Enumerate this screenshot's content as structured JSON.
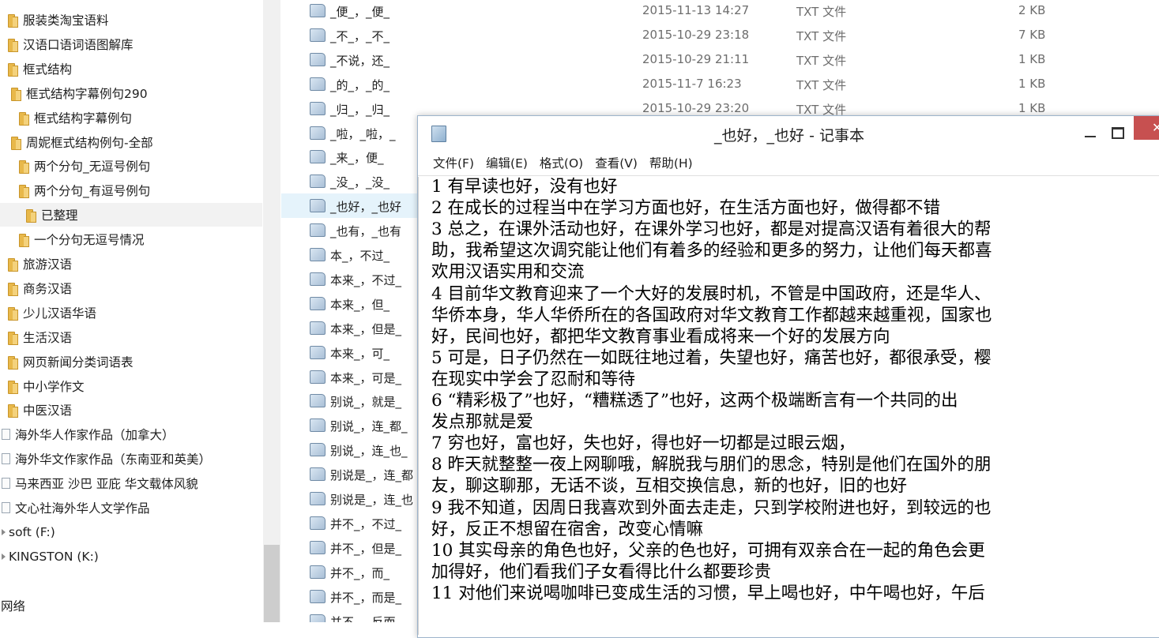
{
  "nav": {
    "items": [
      {
        "label": "服装类淘宝语料",
        "indent": 0,
        "kind": "folder"
      },
      {
        "label": "汉语口语词语图解库",
        "indent": 0,
        "kind": "folder"
      },
      {
        "label": "框式结构",
        "indent": 0,
        "kind": "folder"
      },
      {
        "label": "框式结构字幕例句290",
        "indent": 1,
        "kind": "folder"
      },
      {
        "label": "框式结构字幕例句",
        "indent": 2,
        "kind": "folder"
      },
      {
        "label": "周妮框式结构例句-全部",
        "indent": 1,
        "kind": "folder"
      },
      {
        "label": "两个分句_无逗号例句",
        "indent": 2,
        "kind": "folder"
      },
      {
        "label": "两个分句_有逗号例句",
        "indent": 2,
        "kind": "folder"
      },
      {
        "label": "已整理",
        "indent": 3,
        "kind": "folder",
        "selected": true
      },
      {
        "label": "一个分句无逗号情况",
        "indent": 2,
        "kind": "folder"
      },
      {
        "label": "旅游汉语",
        "indent": 0,
        "kind": "folder"
      },
      {
        "label": "商务汉语",
        "indent": 0,
        "kind": "folder"
      },
      {
        "label": "少儿汉语华语",
        "indent": 0,
        "kind": "folder"
      },
      {
        "label": "生活汉语",
        "indent": 0,
        "kind": "folder"
      },
      {
        "label": "网页新闻分类词语表",
        "indent": 0,
        "kind": "folder"
      },
      {
        "label": "中小学作文",
        "indent": 0,
        "kind": "folder"
      },
      {
        "label": "中医汉语",
        "indent": 0,
        "kind": "folder"
      },
      {
        "label": "海外华人作家作品（加拿大）",
        "indent": 0,
        "kind": "docset"
      },
      {
        "label": "海外华文作家作品（东南亚和英美）",
        "indent": 0,
        "kind": "docset"
      },
      {
        "label": "马来西亚 沙巴 亚庇 华文载体风貌",
        "indent": 0,
        "kind": "docset"
      },
      {
        "label": "文心社海外华人文学作品",
        "indent": 0,
        "kind": "docset"
      },
      {
        "label": "soft (F:)",
        "indent": 0,
        "kind": "drive"
      },
      {
        "label": "KINGSTON (K:)",
        "indent": 0,
        "kind": "drive"
      },
      {
        "label": "",
        "indent": 0,
        "kind": "blank"
      },
      {
        "label": "网络",
        "indent": 0,
        "kind": "network"
      }
    ]
  },
  "files": [
    {
      "name": "_便_，_便_",
      "date": "2015-11-13 14:27",
      "type": "TXT 文件",
      "size": "2 KB"
    },
    {
      "name": "_不_，_不_",
      "date": "2015-10-29 23:18",
      "type": "TXT 文件",
      "size": "7 KB"
    },
    {
      "name": "_不说，还_",
      "date": "2015-10-29 21:11",
      "type": "TXT 文件",
      "size": "1 KB"
    },
    {
      "name": "_的_，_的_",
      "date": "2015-11-7 16:23",
      "type": "TXT 文件",
      "size": "1 KB"
    },
    {
      "name": "_归_，_归_",
      "date": "2015-10-29 23:20",
      "type": "TXT 文件",
      "size": "1 KB"
    },
    {
      "name": "_啦，_啦，_",
      "date": "",
      "type": "",
      "size": ""
    },
    {
      "name": "_来_，便_",
      "date": "",
      "type": "",
      "size": ""
    },
    {
      "name": "_没_，_没_",
      "date": "",
      "type": "",
      "size": ""
    },
    {
      "name": "_也好，_也好",
      "date": "",
      "type": "",
      "size": "",
      "selected": true
    },
    {
      "name": "_也有，_也有",
      "date": "",
      "type": "",
      "size": ""
    },
    {
      "name": "本_，不过_",
      "date": "",
      "type": "",
      "size": ""
    },
    {
      "name": "本来_，不过_",
      "date": "",
      "type": "",
      "size": ""
    },
    {
      "name": "本来_，但_",
      "date": "",
      "type": "",
      "size": ""
    },
    {
      "name": "本来_，但是_",
      "date": "",
      "type": "",
      "size": ""
    },
    {
      "name": "本来_，可_",
      "date": "",
      "type": "",
      "size": ""
    },
    {
      "name": "本来_，可是_",
      "date": "",
      "type": "",
      "size": ""
    },
    {
      "name": "别说_，就是_",
      "date": "",
      "type": "",
      "size": ""
    },
    {
      "name": "别说_，连_都_",
      "date": "",
      "type": "",
      "size": ""
    },
    {
      "name": "别说_，连_也_",
      "date": "",
      "type": "",
      "size": ""
    },
    {
      "name": "别说是_，连_都",
      "date": "",
      "type": "",
      "size": ""
    },
    {
      "name": "别说是_，连_也",
      "date": "",
      "type": "",
      "size": ""
    },
    {
      "name": "并不_，不过_",
      "date": "",
      "type": "",
      "size": ""
    },
    {
      "name": "并不_，但是_",
      "date": "",
      "type": "",
      "size": ""
    },
    {
      "name": "并不_，而_",
      "date": "",
      "type": "",
      "size": ""
    },
    {
      "name": "并不_，而是_",
      "date": "",
      "type": "",
      "size": ""
    },
    {
      "name": "并不_，反而_",
      "date": "",
      "type": "",
      "size": ""
    }
  ],
  "notepad": {
    "title": "_也好，_也好 - 记事本",
    "menu": [
      "文件(F)",
      "编辑(E)",
      "格式(O)",
      "查看(V)",
      "帮助(H)"
    ],
    "lines": [
      "1 有早读也好，没有也好",
      "2 在成长的过程当中在学习方面也好，在生活方面也好，做得都不错",
      "3 总之，在课外活动也好，在课外学习也好，都是对提高汉语有着很大的帮",
      "助，我希望这次调究能让他们有着多的经验和更多的努力，让他们每天都喜",
      "欢用汉语实用和交流",
      "4 目前华文教育迎来了一个大好的发展时机，不管是中国政府，还是华人、",
      "华侨本身，华人华侨所在的各国政府对华文教育工作都越来越重视，国家也",
      "好，民间也好，都把华文教育事业看成将来一个好的发展方向",
      "5 可是，日子仍然在一如既往地过着，失望也好，痛苦也好，都很承受，樱",
      "在现实中学会了忍耐和等待",
      "6 “精彩极了”也好，“糟糕透了”也好，这两个极端断言有一个共同的出",
      "发点那就是爱",
      "7 穷也好，富也好，失也好，得也好一切都是过眼云烟，",
      "8 昨天就整整一夜上网聊哦，解脱我与朋们的思念，特别是他们在国外的朋",
      "友，聊这聊那，无话不谈，互相交换信息，新的也好，旧的也好",
      "9 我不知道，因周日我喜欢到外面去走走，只到学校附进也好，到较远的也",
      "好，反正不想留在宿舍，改变心情嘛",
      "10 其实母亲的角色也好，父亲的色也好，可拥有双亲合在一起的角色会更",
      "加得好，他们看我们子女看得比什么都要珍贵",
      "11 对他们来说喝咖啡已变成生活的习惯，早上喝也好，中午喝也好，午后"
    ]
  }
}
